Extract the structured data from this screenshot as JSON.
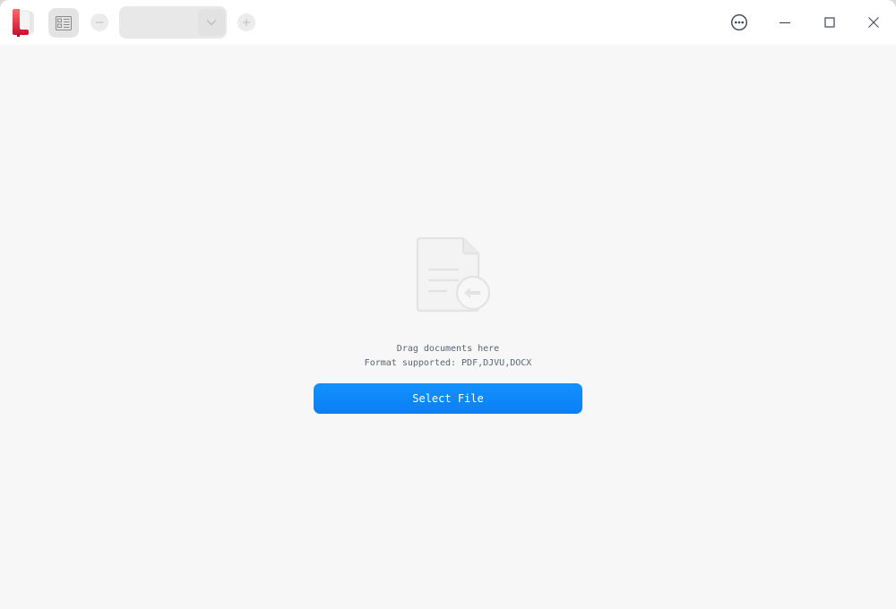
{
  "app": {
    "logo_icon": "document-viewer-logo-icon",
    "accent_color": "#1a86ff"
  },
  "toolbar": {
    "sidebar_toggle_icon": "thumbnail-sidebar-icon",
    "zoom_out_icon": "minus-icon",
    "zoom_in_icon": "plus-icon",
    "zoom_value": "",
    "zoom_dropdown_icon": "chevron-down-icon"
  },
  "window_controls": {
    "menu_icon": "more-options-icon",
    "minimize_icon": "minimize-icon",
    "maximize_icon": "maximize-icon",
    "close_icon": "close-icon"
  },
  "empty_state": {
    "illustration_icon": "import-document-icon",
    "drag_text": "Drag documents here",
    "format_text": "Format supported: PDF,DJVU,DOCX",
    "select_button_label": "Select File"
  }
}
